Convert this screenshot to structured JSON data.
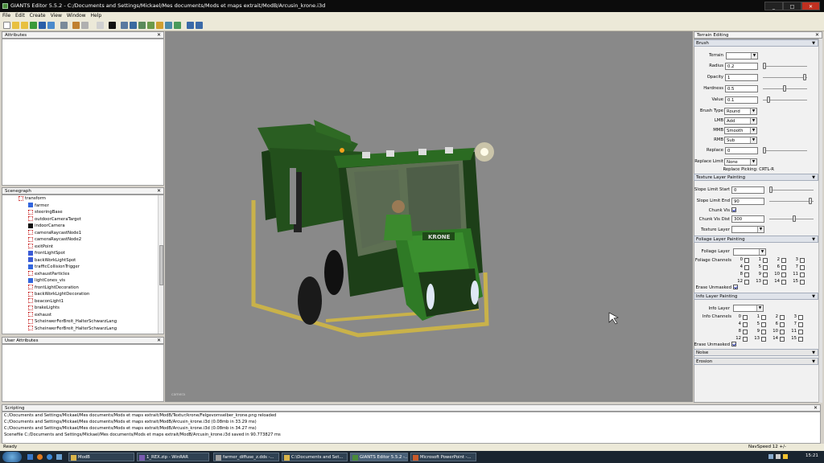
{
  "window": {
    "title": "GIANTS Editor 5.5.2 - C:/Documents and Settings/Mickael/Mes documents/Mods et maps extrait/ModB/Arcusin_krone.i3d"
  },
  "menu": [
    "File",
    "Edit",
    "Create",
    "View",
    "Window",
    "Help"
  ],
  "panels": {
    "attributes": "Attributes",
    "scenegraph": "Scenegraph",
    "user_attributes": "User Attributes",
    "terrain_editing": "Terrain Editing",
    "scripting": "Scripting"
  },
  "scenegraph": [
    {
      "name": "transform",
      "icon": "transform",
      "depth": 2
    },
    {
      "name": "farmer",
      "icon": "shape",
      "depth": 3
    },
    {
      "name": "steeringBase",
      "icon": "transform",
      "depth": 3
    },
    {
      "name": "outdoorCameraTarget",
      "icon": "transform",
      "depth": 3
    },
    {
      "name": "indoorCamera",
      "icon": "camera",
      "depth": 3
    },
    {
      "name": "cameraRaycastNode1",
      "icon": "transform",
      "depth": 3
    },
    {
      "name": "cameraRaycastNode2",
      "icon": "transform",
      "depth": 3
    },
    {
      "name": "exitPoint",
      "icon": "transform",
      "depth": 3
    },
    {
      "name": "frontLightSpot",
      "icon": "light",
      "depth": 3
    },
    {
      "name": "backWorkLightSpot",
      "icon": "light",
      "depth": 3
    },
    {
      "name": "trafficCollisionTrigger",
      "icon": "shape",
      "depth": 3
    },
    {
      "name": "exhaustParticles",
      "icon": "transform",
      "depth": 3
    },
    {
      "name": "lightCones_vis",
      "icon": "shape",
      "depth": 3
    },
    {
      "name": "frontLightDecoration",
      "icon": "transform",
      "depth": 3
    },
    {
      "name": "backWorkLightDecoration",
      "icon": "transform",
      "depth": 3
    },
    {
      "name": "beaconLight1",
      "icon": "transform",
      "depth": 3
    },
    {
      "name": "brakeLights",
      "icon": "transform",
      "depth": 3
    },
    {
      "name": "exhaust",
      "icon": "transform",
      "depth": 3
    },
    {
      "name": "ScheinwerFerBreit_HalterSchwarzLang",
      "icon": "transform",
      "depth": 3
    },
    {
      "name": "ScheinwerFerBreit_HalterSchwarzLang",
      "icon": "transform",
      "depth": 3
    }
  ],
  "viewport": {
    "label": "camera"
  },
  "brush": {
    "header": "Brush",
    "terrain_label": "Terrain",
    "terrain_value": "",
    "radius_label": "Radius",
    "radius_value": "0.2",
    "opacity_label": "Opacity",
    "opacity_value": "1",
    "hardness_label": "Hardness",
    "hardness_value": "0.5",
    "value_label": "Value",
    "value_value": "0.1",
    "brush_type_label": "Brush Type",
    "brush_type_value": "Round",
    "lmb_label": "LMB",
    "lmb_value": "Add",
    "mmb_label": "MMB",
    "mmb_value": "Smooth",
    "rmb_label": "RMB",
    "rmb_value": "Sub",
    "replace_label": "Replace",
    "replace_value": "0",
    "replace_limit_label": "Replace Limit",
    "replace_limit_value": "None",
    "replace_picking": "Replace Picking: CRTL-R"
  },
  "texture": {
    "header": "Texture Layer Painting",
    "slope_start_label": "Slope Limit Start",
    "slope_start_value": "0",
    "slope_end_label": "Slope Limit End",
    "slope_end_value": "90",
    "chunk_vis_label": "Chunk Vis",
    "chunk_vis_dist_label": "Chunk Vis Dist",
    "chunk_vis_dist_value": "300",
    "texture_layer_label": "Texture Layer"
  },
  "foliage": {
    "header": "Foliage Layer Painting",
    "layer_label": "Foliage Layer",
    "channels_label": "Foliage Channels",
    "erase_label": "Erase Unmasked"
  },
  "info": {
    "header": "Info Layer Painting",
    "layer_label": "Info Layer",
    "channels_label": "Info Channels",
    "erase_label": "Erase Unmasked"
  },
  "noise": {
    "header": "Noise"
  },
  "erosion": {
    "header": "Erosion"
  },
  "channels": [
    "0",
    "1",
    "2",
    "3",
    "4",
    "5",
    "6",
    "7",
    "8",
    "9",
    "10",
    "11",
    "12",
    "13",
    "14",
    "15"
  ],
  "scripting_lines": [
    "C:/Documents and Settings/Mickael/Mes documents/Mods et maps extrait/ModB/Textur/krone/Felgevornselber_krone.png reloaded",
    "C:/Documents and Settings/Mickael/Mes documents/Mods et maps extrait/ModB/Arcusin_krone.i3d (0.08mb in 33.29 ms)",
    "C:/Documents and Settings/Mickael/Mes documents/Mods et maps extrait/ModB/Arcusin_krone.i3d (0.08mb in 34.27 ms)",
    "Scenefile C:/Documents and Settings/Mickael/Mes documents/Mods et maps extrait/ModB/Arcusin_krone.i3d saved in 90.773827 ms"
  ],
  "status": {
    "left": "Ready",
    "right": "NavSpeed 12 +/-"
  },
  "taskbar": {
    "start": "",
    "tasks": [
      "ModB",
      "1_REX.zip - WinRAR",
      "farmer_diffuse_z.dds -...",
      "C:\\Documents and Set...",
      "GIANTS Editor 5.5.2 -...",
      "Microsoft PowerPoint -..."
    ],
    "clock": "15:21"
  }
}
